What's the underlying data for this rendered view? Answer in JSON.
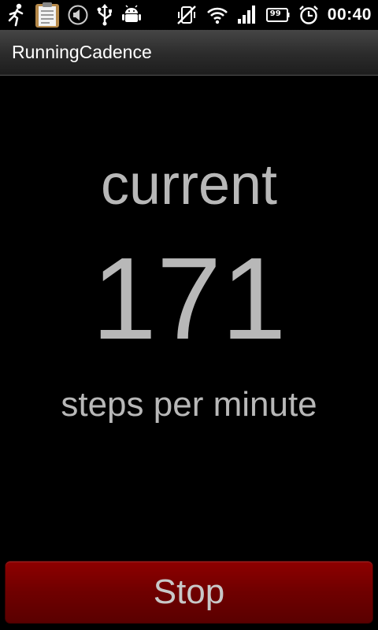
{
  "status_bar": {
    "time": "00:40",
    "battery_level": "99",
    "notification_icons": [
      "runner-icon",
      "clipboard-icon",
      "sound-off-icon",
      "usb-icon",
      "android-debug-icon"
    ],
    "system_icons": [
      "vibrate-off-icon",
      "wifi-icon",
      "signal-icon",
      "battery-icon",
      "alarm-clock-icon"
    ]
  },
  "app": {
    "title": "RunningCadence"
  },
  "cadence": {
    "label": "current",
    "value": "171",
    "unit": "steps per minute"
  },
  "stop_button": {
    "label": "Stop",
    "color": "#7a0000"
  }
}
